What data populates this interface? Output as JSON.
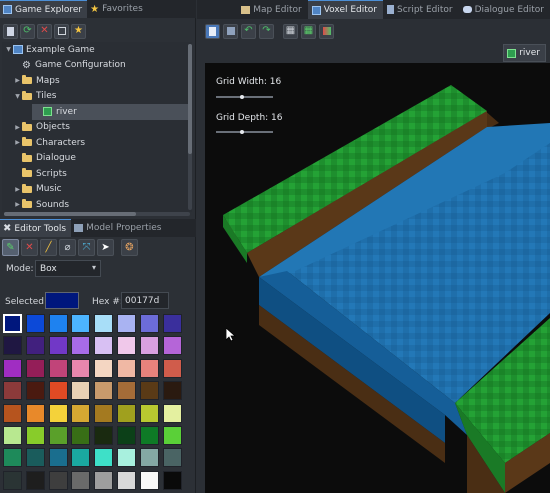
{
  "left_tabs": [
    {
      "label": "Game Explorer",
      "icon": "game-explorer-icon",
      "active": true
    },
    {
      "label": "Favorites",
      "icon": "star-icon",
      "active": false
    }
  ],
  "explorer_toolbar": [
    "add-file-icon",
    "refresh-icon",
    "delete-icon",
    "collapse-icon",
    "favorite-icon"
  ],
  "tree": [
    {
      "label": "Example Game",
      "indent": 0,
      "icon": "project-icon",
      "arrow": "down"
    },
    {
      "label": "Game Configuration",
      "indent": 1,
      "icon": "gear-icon",
      "arrow": ""
    },
    {
      "label": "Maps",
      "indent": 1,
      "icon": "folder-icon",
      "arrow": "right"
    },
    {
      "label": "Tiles",
      "indent": 1,
      "icon": "folder-icon",
      "arrow": "down"
    },
    {
      "label": "river",
      "indent": 2,
      "icon": "voxel-icon",
      "arrow": "",
      "selected": true
    },
    {
      "label": "Objects",
      "indent": 1,
      "icon": "folder-icon",
      "arrow": "right"
    },
    {
      "label": "Characters",
      "indent": 1,
      "icon": "folder-icon",
      "arrow": "right"
    },
    {
      "label": "Dialogue",
      "indent": 1,
      "icon": "folder-icon",
      "arrow": ""
    },
    {
      "label": "Scripts",
      "indent": 1,
      "icon": "folder-icon",
      "arrow": ""
    },
    {
      "label": "Music",
      "indent": 1,
      "icon": "folder-icon",
      "arrow": "right"
    },
    {
      "label": "Sounds",
      "indent": 1,
      "icon": "folder-icon",
      "arrow": "right"
    }
  ],
  "bottom_tabs": [
    {
      "label": "Editor Tools",
      "icon": "tools-icon",
      "active": true
    },
    {
      "label": "Model Properties",
      "icon": "properties-icon",
      "active": false
    }
  ],
  "tools": [
    "place-voxel-icon",
    "erase-icon",
    "paint-icon",
    "eyedropper-icon",
    "select-icon",
    "pointer-icon",
    "fill-icon"
  ],
  "mode": {
    "label": "Mode:",
    "value": "Box"
  },
  "selected": {
    "label": "Selected:",
    "color": "#00177d",
    "hex_label": "Hex #:",
    "hex_value": "00177d"
  },
  "palette": [
    "#00177d",
    "#0c49d8",
    "#1e82f0",
    "#4cb4ff",
    "#a8def8",
    "#a9b3f2",
    "#6c6cd8",
    "#3a2f9c",
    "#1f1742",
    "#41207e",
    "#7138c7",
    "#a76be8",
    "#d8c0f3",
    "#f0c8ea",
    "#d9a0e0",
    "#b565d8",
    "#a02dc2",
    "#941e58",
    "#c14479",
    "#e886ad",
    "#f4d6c2",
    "#f0b8a4",
    "#e8827c",
    "#d05c4b",
    "#8c3a3a",
    "#4a1a10",
    "#e04a24",
    "#e8d0b4",
    "#c89a6c",
    "#a46c38",
    "#5a3a16",
    "#2a1a10",
    "#b6541e",
    "#e8892a",
    "#f4d23a",
    "#d6a832",
    "#a47a20",
    "#a0a01e",
    "#b8c830",
    "#e4f0a0",
    "#b8e890",
    "#88cc2a",
    "#5aa02a",
    "#386e16",
    "#1a2a10",
    "#0c4018",
    "#0e7a26",
    "#5ad038",
    "#1e8a5a",
    "#1a5c5c",
    "#1a6e8e",
    "#1aa8a0",
    "#3ee0c8",
    "#a8f0de",
    "#84a8a4",
    "#4a6464",
    "#2a3434",
    "#1e1e1e",
    "#3e3e3e",
    "#6a6a6a",
    "#9e9e9e",
    "#d8d8d8",
    "#f8f8f8",
    "#0a0a0a"
  ],
  "right_tabs": [
    {
      "label": "Map Editor",
      "icon": "map-icon",
      "active": false
    },
    {
      "label": "Voxel Editor",
      "icon": "voxel-editor-icon",
      "active": true
    },
    {
      "label": "Script Editor",
      "icon": "script-icon",
      "active": false
    },
    {
      "label": "Dialogue Editor",
      "icon": "dialogue-icon",
      "active": false
    }
  ],
  "editor_toolbar": [
    "new-icon",
    "save-icon",
    "undo-icon",
    "redo-icon",
    "grid-icon",
    "layers-icon",
    "palette-icon"
  ],
  "viewport_tab": {
    "label": "river",
    "icon": "voxel-icon"
  },
  "grid": {
    "width_label": "Grid Width: 16",
    "width": 16,
    "depth_label": "Grid Depth: 16",
    "depth": 16
  }
}
